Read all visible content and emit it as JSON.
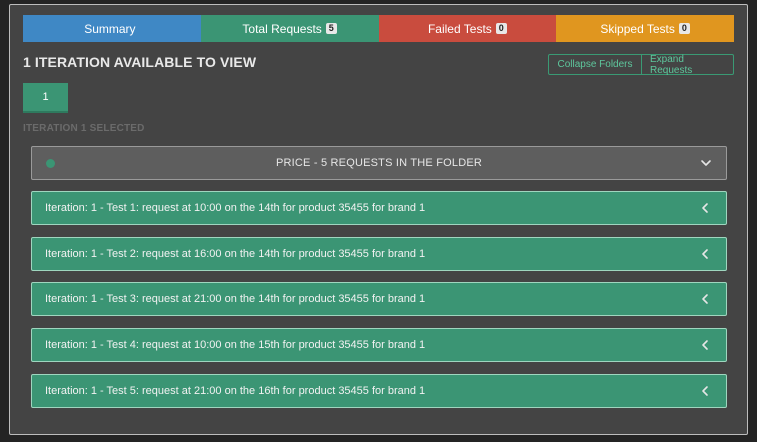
{
  "tabs": [
    {
      "label": "Summary",
      "badge": null,
      "color": "#3f88c5"
    },
    {
      "label": "Total Requests",
      "badge": "5",
      "color": "#3b9574"
    },
    {
      "label": "Failed Tests",
      "badge": "0",
      "color": "#c94c3e"
    },
    {
      "label": "Skipped Tests",
      "badge": "0",
      "color": "#e0961f"
    }
  ],
  "heading": "1 ITERATION AVAILABLE TO VIEW",
  "buttons": {
    "collapse": "Collapse Folders",
    "expand": "Expand Requests"
  },
  "iteration_button": "1",
  "selected_label": "ITERATION 1 SELECTED",
  "folder": {
    "title": "PRICE - 5 REQUESTS IN THE FOLDER",
    "status_icon": "circle-icon",
    "toggle_icon": "chevron-down-icon"
  },
  "requests": [
    "Iteration: 1 - Test 1: request at 10:00 on the 14th for product 35455 for brand 1",
    "Iteration: 1 - Test 2: request at 16:00 on the 14th for product 35455 for brand 1",
    "Iteration: 1 - Test 3: request at 21:00 on the 14th for product 35455 for brand 1",
    "Iteration: 1 - Test 4: request at 10:00 on the 15th for product 35455 for brand 1",
    "Iteration: 1 - Test 5: request at 21:00 on the 16th for product 35455 for brand 1"
  ],
  "colors": {
    "accent_green": "#3b9574",
    "background": "#444444"
  }
}
